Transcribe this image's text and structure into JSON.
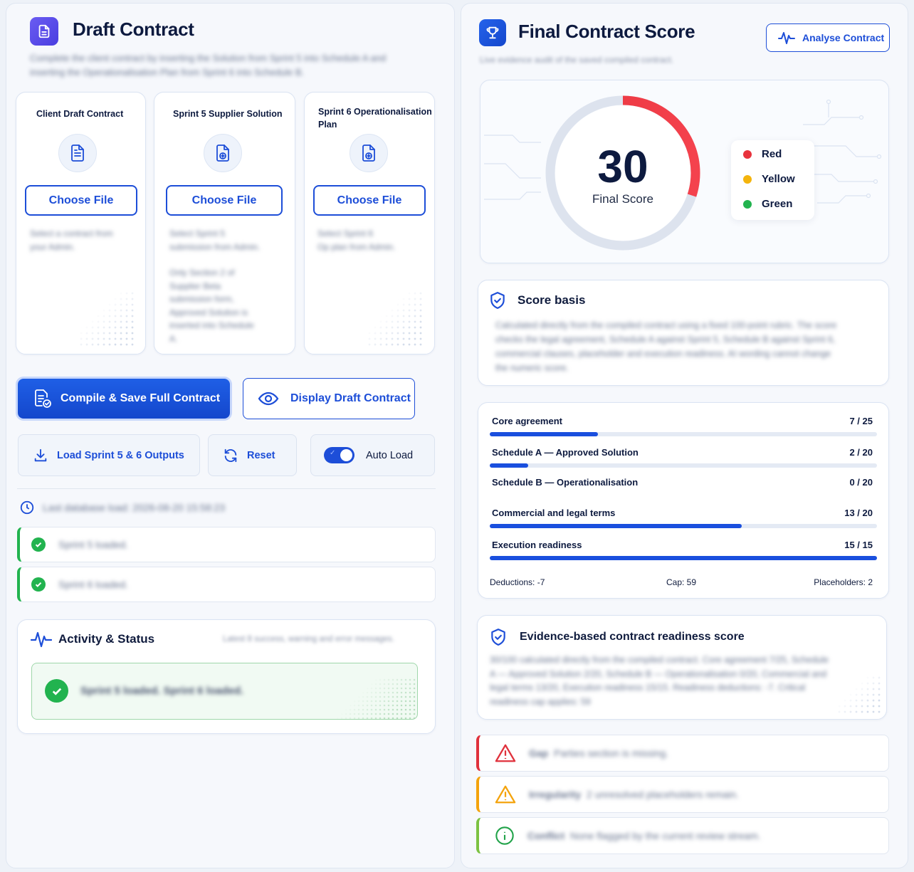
{
  "left": {
    "title": "Draft Contract",
    "subtitle_line1": "Complete the client contract by inserting the Solution from Sprint 5 into Schedule A and",
    "subtitle_line2": "inserting the Operationalisation Plan from Sprint 6 into Schedule B.",
    "uploads": [
      {
        "title": "Client Draft Contract",
        "button": "Choose File",
        "desc": [
          "Select a contract from",
          "your Admin."
        ],
        "icon": "document-icon"
      },
      {
        "title": "Sprint 5 Supplier Solution",
        "button": "Choose File",
        "desc": [
          "Select Sprint 5",
          "submission from Admin.",
          "",
          "Only Section 2 of",
          "Supplier Beta",
          "submission form,",
          "Approved Solution is",
          "inserted into Schedule",
          "A."
        ],
        "icon": "file-plus-icon"
      },
      {
        "title": "Sprint 6 Operationalisation Plan",
        "button": "Choose File",
        "desc": [
          "Select Sprint 6",
          "Op plan from Admin."
        ],
        "icon": "file-plus-icon"
      }
    ],
    "compile_button": "Compile & Save Full Contract",
    "display_button": "Display Draft Contract",
    "load_button": "Load Sprint 5 & 6 Outputs",
    "reset_button": "Reset",
    "auto_load_label": "Auto Load",
    "auto_load_on": true,
    "last_load": "Last database load: 2026-08-20 15:58:23",
    "status_rows": [
      "Sprint 5 loaded.",
      "Sprint 6 loaded."
    ],
    "activity": {
      "title": "Activity & Status",
      "hint": "Latest 8 success, warning and error messages.",
      "message": "Sprint 5 loaded. Sprint 6 loaded."
    }
  },
  "right": {
    "title": "Final Contract Score",
    "subtitle": "Live evidence audit of the saved compiled contract.",
    "analyse_button": "Analyse Contract",
    "score": {
      "value": "30",
      "label": "Final Score",
      "max": 100,
      "fraction": 0.3
    },
    "legend": [
      {
        "label": "Red",
        "color": "#e8333d"
      },
      {
        "label": "Yellow",
        "color": "#f4b40c"
      },
      {
        "label": "Green",
        "color": "#22b34f"
      }
    ],
    "score_basis": {
      "title": "Score basis",
      "text": [
        "Calculated directly from the compiled contract using a fixed 100-point rubric. The score",
        "checks the legal agreement, Schedule A against Sprint 5, Schedule B against Sprint 6,",
        "commercial clauses, placeholder and execution readiness. AI wording cannot change",
        "the numeric score."
      ]
    },
    "bars": [
      {
        "label": "Core agreement",
        "value": "7 / 25",
        "fraction": 0.28
      },
      {
        "label": "Schedule A — Approved Solution",
        "value": "2 / 20",
        "fraction": 0.1
      },
      {
        "label": "Schedule B — Operationalisation",
        "value": "0 / 20",
        "fraction": 0
      },
      {
        "label": "Commercial and legal terms",
        "value": "13 / 20",
        "fraction": 0.65
      },
      {
        "label": "Execution readiness",
        "value": "15 / 15",
        "fraction": 1.0
      }
    ],
    "footer": {
      "deductions": "Deductions: -7",
      "cap": "Cap: 59",
      "placeholders": "Placeholders: 2"
    },
    "evidence": {
      "title": "Evidence-based contract readiness score",
      "text": [
        "30/100 calculated directly from the compiled contract. Core agreement 7/25, Schedule",
        "A — Approved Solution 2/20, Schedule B — Operationalisation 0/20, Commercial and",
        "legal terms 13/20, Execution readiness 15/15. Readiness deductions: -7. Critical",
        "readiness cap applies: 59"
      ]
    },
    "issues": [
      {
        "label": "Gap",
        "text": "Parties section is missing.",
        "color": "#e0313c",
        "icon": "warning-triangle-icon"
      },
      {
        "label": "Irregularity",
        "text": "2 unresolved placeholders remain.",
        "color": "#f4a30c",
        "icon": "warning-triangle-icon"
      },
      {
        "label": "Conflict",
        "text": "None flagged by the current review stream.",
        "color": "#7cc242",
        "icon": "info-icon"
      }
    ]
  }
}
